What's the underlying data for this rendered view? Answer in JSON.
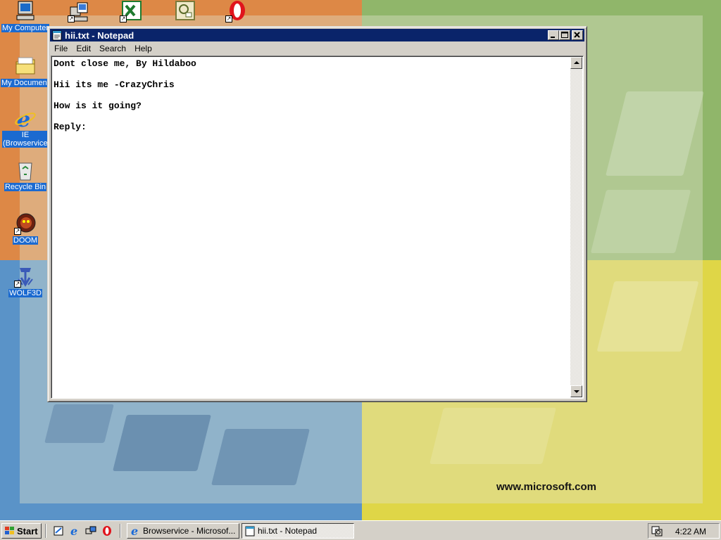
{
  "desktop": {
    "watermark": "www.microsoft.com",
    "icons": [
      {
        "label": "My Computer"
      },
      {
        "label": "My Documents"
      },
      {
        "label": "IE (Browservice)"
      },
      {
        "label": "Recycle Bin"
      },
      {
        "label": "DOOM"
      },
      {
        "label": "WOLF3D"
      }
    ],
    "top_icons": [
      "network-shortcut-icon",
      "excel-shortcut-icon",
      "outlook-shortcut-icon",
      "opera-shortcut-icon"
    ]
  },
  "window": {
    "title": "hii.txt - Notepad",
    "menu": {
      "file": "File",
      "edit": "Edit",
      "search": "Search",
      "help": "Help"
    },
    "text_lines": [
      "Dont close me, By Hildaboo",
      "Hii its me -CrazyChris",
      "How is it going?",
      "Reply:"
    ]
  },
  "taskbar": {
    "start_label": "Start",
    "quicklaunch": [
      "show-desktop-icon",
      "ie-icon",
      "network-icon",
      "opera-icon"
    ],
    "tasks": [
      {
        "label": "Browservice - Microsof...",
        "icon": "ie-icon"
      },
      {
        "label": "hii.txt - Notepad",
        "icon": "notepad-icon",
        "active": true
      }
    ],
    "clock": "4:22 AM"
  },
  "colors": {
    "titlebar": "#0a246a",
    "icon_label_bg": "#1b6ad0",
    "wall_orange": "#dd8846",
    "wall_green": "#90b66a",
    "wall_blue": "#5a93c8",
    "wall_yellow": "#dfd647"
  }
}
